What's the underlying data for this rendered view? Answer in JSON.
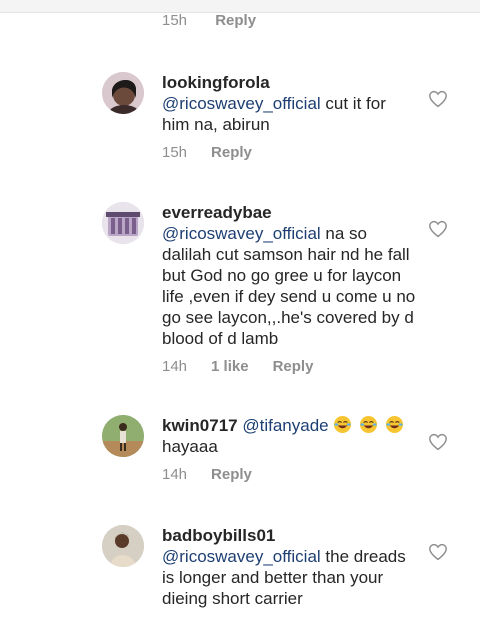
{
  "top_row": {
    "time": "15h",
    "reply": "Reply"
  },
  "comments": [
    {
      "username": "lookingforola",
      "mention": "@ricoswavey_official",
      "text": " cut it for him na, abirun",
      "time": "15h",
      "likes": "",
      "reply": "Reply"
    },
    {
      "username": "everreadybae",
      "mention": "@ricoswavey_official",
      "text": " na so dalilah cut samson hair nd he fall but God no go gree u for laycon life ,even if dey send u come u no go see laycon,,.he's covered by d blood of d lamb",
      "time": "14h",
      "likes": "1 like",
      "reply": "Reply"
    },
    {
      "username": "kwin0717",
      "mention": "@tifanyade",
      "emoji": "😂😂😂",
      "text": "hayaaa",
      "time": "14h",
      "likes": "",
      "reply": "Reply"
    },
    {
      "username": "badboybills01",
      "mention": "@ricoswavey_official",
      "text": " the dreads is longer and better than your dieing short carrier",
      "time": "",
      "likes": "",
      "reply": ""
    }
  ],
  "icons": {
    "like": "heart-outline-icon",
    "avatar": "avatar"
  },
  "colors": {
    "mention": "#1d3f73",
    "meta": "#8e8e8e",
    "text": "#262626"
  }
}
